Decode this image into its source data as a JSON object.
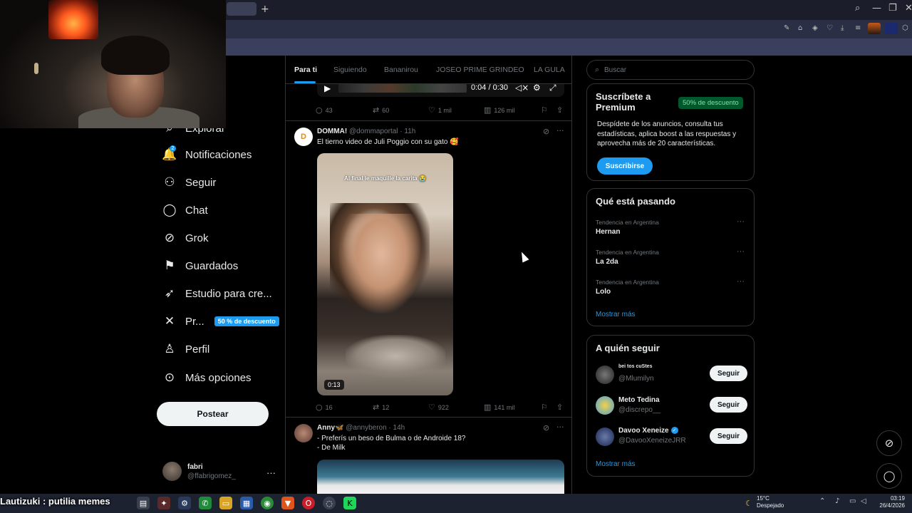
{
  "browser": {
    "new_tab": "+",
    "window_controls": [
      "⌕",
      "—",
      "❐",
      "✕"
    ],
    "toolbar_icons": [
      "edit-icon",
      "camera-icon",
      "shield-icon",
      "heart-icon",
      "download-icon",
      "menu-icon"
    ]
  },
  "sidebar": {
    "items": [
      {
        "label": "Explorar",
        "icon": "search-icon",
        "glyph": "⌕"
      },
      {
        "label": "Notificaciones",
        "icon": "bell-icon",
        "glyph": "🔔",
        "badge": "2"
      },
      {
        "label": "Seguir",
        "icon": "person-add-icon",
        "glyph": "👤"
      },
      {
        "label": "Chat",
        "icon": "chat-bubble-icon",
        "glyph": "💬"
      },
      {
        "label": "Grok",
        "icon": "grok-icon",
        "glyph": "⊘"
      },
      {
        "label": "Guardados",
        "icon": "bookmark-icon",
        "glyph": "🔖"
      },
      {
        "label": "Estudio para cre...",
        "icon": "rocket-icon",
        "glyph": "🚀"
      },
      {
        "label": "Pr...",
        "icon": "x-logo-icon",
        "glyph": "𝕏",
        "badge": "50 % de descuento"
      },
      {
        "label": "Perfil",
        "icon": "profile-icon",
        "glyph": "👤"
      },
      {
        "label": "Más opciones",
        "icon": "more-circle-icon",
        "glyph": "⋯"
      }
    ],
    "post_button": "Postear",
    "user": {
      "name": "fabri",
      "handle": "@ffabrigomez_",
      "more": "···"
    }
  },
  "feed": {
    "tabs": [
      "Para ti",
      "Siguiendo",
      "Bananirou",
      "JOSEO PRIME GRINDEO",
      "LA GULA"
    ],
    "active_tab": 0,
    "video_player": {
      "time": "0:04 / 0:30",
      "play": "▶",
      "mute": "🔇",
      "settings": "⚙",
      "fullscreen": "⛶"
    },
    "post0_actions": {
      "replies": "43",
      "reposts": "60",
      "likes": "1 mil",
      "views": "126 mil"
    },
    "post1": {
      "name": "DOMMA!",
      "handle": "@dommaportal · 11h",
      "text": "El tierno video de Juli Poggio con su gato 🥰",
      "video_caption": "Al final le maquille la carita 😭",
      "duration": "0:13",
      "replies": "16",
      "reposts": "12",
      "likes": "922",
      "views": "141 mil"
    },
    "post2": {
      "name": "Anny🦋",
      "handle": "@annyberon · 14h",
      "text_line1": "- Preferís un beso de Bulma o de Androide 18?",
      "text_line2": "- De Milk"
    }
  },
  "right": {
    "search_placeholder": "Buscar",
    "premium": {
      "title_line1": "Suscríbete a",
      "title_line2": "Premium",
      "badge": "50% de descuento",
      "text": "Despídete de los anuncios, consulta tus estadísticas, aplica boost a las respuestas y aprovecha más de 20 características.",
      "button": "Suscribirse"
    },
    "trends": {
      "title": "Qué está pasando",
      "items": [
        {
          "context": "Tendencia en Argentina",
          "name": "Hernan"
        },
        {
          "context": "Tendencia en Argentina",
          "name": "La 2da"
        },
        {
          "context": "Tendencia en Argentina",
          "name": "Lolo"
        }
      ],
      "show_more": "Mostrar más"
    },
    "who_to_follow": {
      "title": "A quién seguir",
      "items": [
        {
          "name": "bei tos cuStes",
          "handle": "@Mlumilyn",
          "button": "Seguir",
          "color": "#3a3a3a"
        },
        {
          "name": "Meto Tedina",
          "handle": "@discrepo__",
          "button": "Seguir",
          "color": "#4a9fd8"
        },
        {
          "name": "Davoo Xeneize",
          "handle": "@DavooXeneizeJRR",
          "button": "Seguir",
          "color": "#2a3f6a",
          "verified": true
        }
      ],
      "show_more": "Mostrar más"
    }
  },
  "overlay": {
    "stream_text": "Lautizuki : putilia memes"
  },
  "taskbar": {
    "weather_temp": "15°C",
    "weather_desc": "Despejado",
    "time": "03:19",
    "date": "26/4/2026"
  }
}
